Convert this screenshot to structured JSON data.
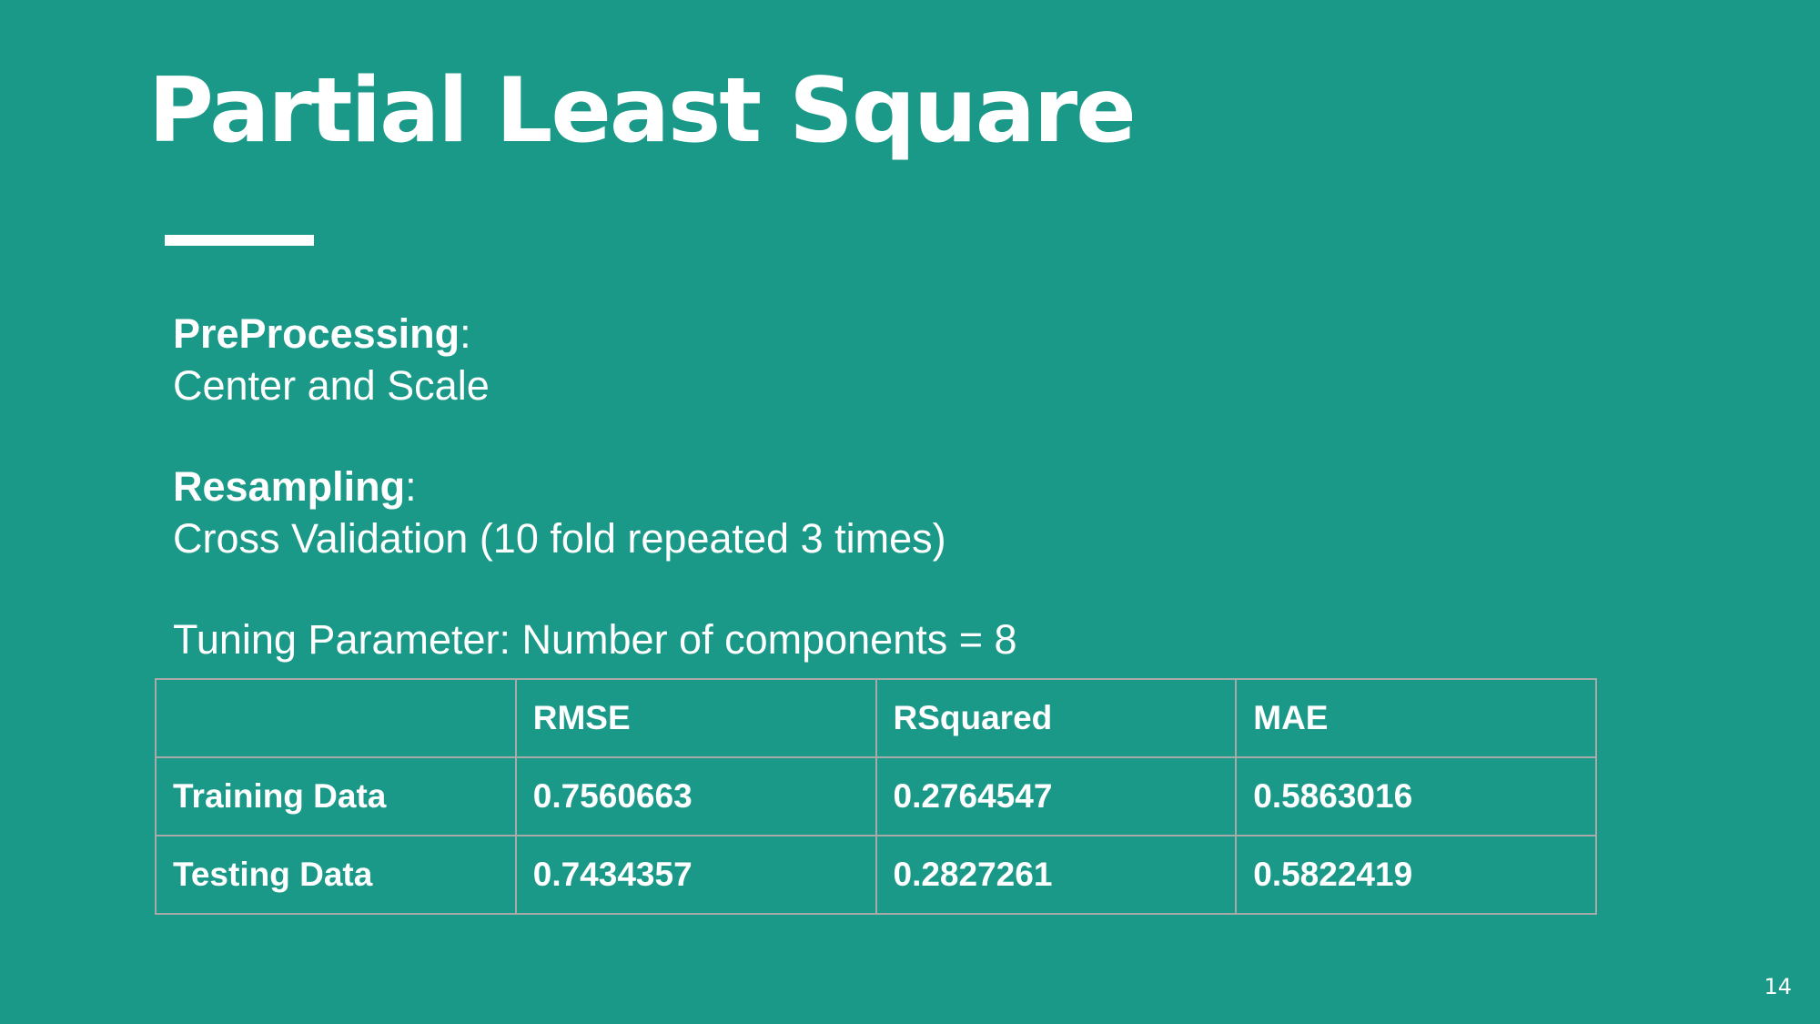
{
  "slide": {
    "title": "Partial Least Square",
    "page_number": "14"
  },
  "content": {
    "preprocessing_label": "PreProcessing",
    "preprocessing_colon": ":",
    "preprocessing_value": "Center and Scale",
    "resampling_label": "Resampling",
    "resampling_colon": ":",
    "resampling_value": "Cross Validation (10 fold repeated 3 times)",
    "tuning": "Tuning Parameter: Number of components = 8"
  },
  "table": {
    "headers": [
      "",
      "RMSE",
      "RSquared",
      "MAE"
    ],
    "rows": [
      [
        "Training Data",
        "0.7560663",
        "0.2764547",
        "0.5863016"
      ],
      [
        "Testing Data",
        "0.7434357",
        "0.2827261",
        "0.5822419"
      ]
    ]
  }
}
